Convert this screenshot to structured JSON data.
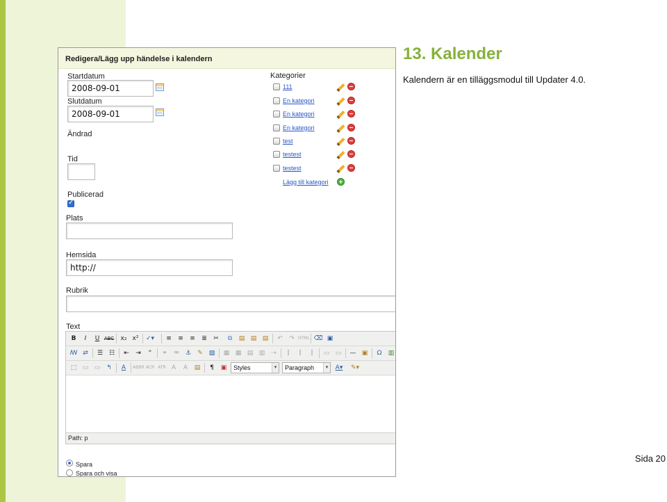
{
  "slide": {
    "title": "13. Kalender",
    "body": "Kalendern är en tilläggsmodul till Updater 4.0.",
    "page_number": "Sida 20"
  },
  "screenshot": {
    "header_title": "Redigera/Lägg upp händelse i kalendern",
    "form": {
      "startdatum_label": "Startdatum",
      "startdatum_value": "2008-09-01",
      "slutdatum_label": "Slutdatum",
      "slutdatum_value": "2008-09-01",
      "andrad_label": "Ändrad",
      "tid_label": "Tid",
      "tid_value": "",
      "publicerad_label": "Publicerad",
      "publicerad_checked": true,
      "plats_label": "Plats",
      "plats_value": "",
      "hemsida_label": "Hemsida",
      "hemsida_value": "http://",
      "rubrik_label": "Rubrik",
      "rubrik_value": "",
      "text_label": "Text"
    },
    "kategorier": {
      "label": "Kategorier",
      "items": [
        {
          "name": "111"
        },
        {
          "name": "En kategori"
        },
        {
          "name": "En kategori"
        },
        {
          "name": "En kategori"
        },
        {
          "name": "test"
        },
        {
          "name": "testest"
        },
        {
          "name": "testest"
        }
      ],
      "add_label": "Lägg till kategori"
    },
    "editor": {
      "styles_select": "Styles",
      "format_select": "Paragraph",
      "path": "Path: p"
    },
    "save_options": {
      "spara": "Spara",
      "spara_och_visa": "Spara och visa"
    }
  },
  "colors": {
    "accent_green": "#86b13b",
    "stripe_dark": "#a9c743",
    "stripe_light": "#eef4d8",
    "link_blue": "#2a56c6"
  }
}
